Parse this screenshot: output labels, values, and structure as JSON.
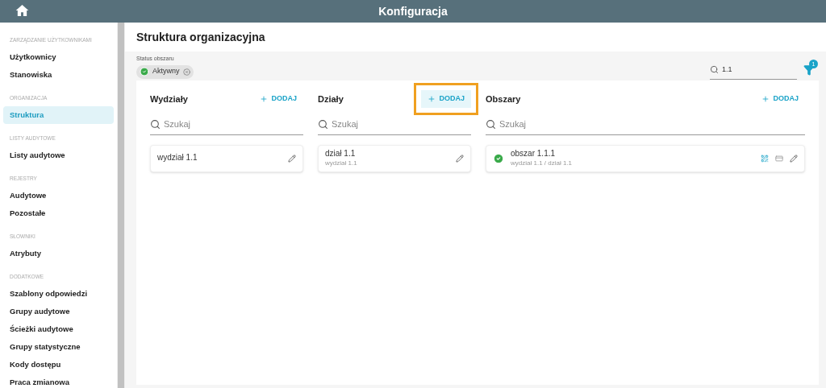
{
  "header": {
    "title": "Konfiguracja"
  },
  "sidebar": {
    "sections": [
      {
        "heading": "ZARZĄDZANIE UŻYTKOWNIKAMI",
        "items": [
          {
            "label": "Użytkownicy",
            "selected": false
          },
          {
            "label": "Stanowiska",
            "selected": false
          }
        ]
      },
      {
        "heading": "ORGANIZACJA",
        "items": [
          {
            "label": "Struktura",
            "selected": true
          }
        ]
      },
      {
        "heading": "LISTY AUDYTOWE",
        "items": [
          {
            "label": "Listy audytowe",
            "selected": false
          }
        ]
      },
      {
        "heading": "REJESTRY",
        "items": [
          {
            "label": "Audytowe",
            "selected": false
          },
          {
            "label": "Pozostałe",
            "selected": false
          }
        ]
      },
      {
        "heading": "SŁOWNIKI",
        "items": [
          {
            "label": "Atrybuty",
            "selected": false
          }
        ]
      },
      {
        "heading": "DODATKOWE",
        "items": [
          {
            "label": "Szablony odpowiedzi",
            "selected": false
          },
          {
            "label": "Grupy audytowe",
            "selected": false
          },
          {
            "label": "Ścieżki audytowe",
            "selected": false
          },
          {
            "label": "Grupy statystyczne",
            "selected": false
          },
          {
            "label": "Kody dostępu",
            "selected": false
          },
          {
            "label": "Praca zmianowa",
            "selected": false
          }
        ]
      }
    ]
  },
  "page_title": "Struktura organizacyjna",
  "filter": {
    "label": "Status obszaru",
    "chip": "Aktywny",
    "search_value": "1.1",
    "filter_count": "1"
  },
  "columns": [
    {
      "title": "Wydziały",
      "add_label": "DODAJ",
      "highlighted": false,
      "search_placeholder": "Szukaj",
      "items": [
        {
          "kind": "plain",
          "name": "wydział 1.1"
        }
      ]
    },
    {
      "title": "Działy",
      "add_label": "DODAJ",
      "highlighted": true,
      "search_placeholder": "Szukaj",
      "items": [
        {
          "kind": "plain",
          "name": "dział 1.1",
          "path": "wydział 1.1"
        }
      ]
    },
    {
      "title": "Obszary",
      "add_label": "DODAJ",
      "highlighted": false,
      "search_placeholder": "Szukaj",
      "items": [
        {
          "kind": "area",
          "name": "obszar 1.1.1",
          "path": "wydział 1.1 / dział 1.1"
        }
      ]
    }
  ]
}
